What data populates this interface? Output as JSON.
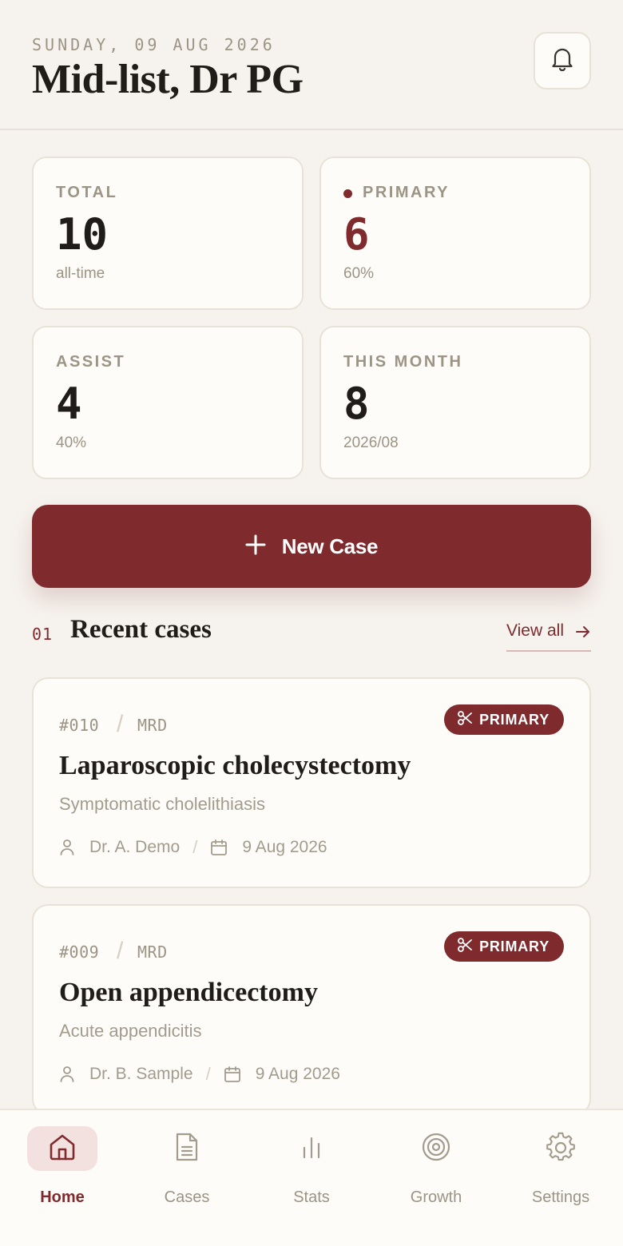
{
  "header": {
    "date": "SUNDAY, 09 AUG 2026",
    "title": "Mid-list, Dr PG",
    "notification_icon": "bell-icon"
  },
  "stats": [
    {
      "label": "TOTAL",
      "value": "10",
      "sub": "all-time"
    },
    {
      "label": "PRIMARY",
      "value": "6",
      "sub": "60%"
    },
    {
      "label": "ASSIST",
      "value": "4",
      "sub": "40%"
    },
    {
      "label": "THIS MONTH",
      "value": "8",
      "sub": "2026/08"
    }
  ],
  "new_case": {
    "label": "New Case",
    "icon": "plus-icon"
  },
  "recent": {
    "number": "01",
    "title": "Recent cases",
    "view_all": "View all"
  },
  "cases": [
    {
      "id": "#010",
      "unit": "MRD",
      "badge": "PRIMARY",
      "title": "Laparoscopic cholecystectomy",
      "diagnosis": "Symptomatic cholelithiasis",
      "doctor": "Dr. A. Demo",
      "date": "9 Aug 2026"
    },
    {
      "id": "#009",
      "unit": "MRD",
      "badge": "PRIMARY",
      "title": "Open appendicectomy",
      "diagnosis": "Acute appendicitis",
      "doctor": "Dr. B. Sample",
      "date": "9 Aug 2026"
    }
  ],
  "nav": [
    {
      "label": "Home",
      "icon": "home-icon",
      "active": true
    },
    {
      "label": "Cases",
      "icon": "document-icon",
      "active": false
    },
    {
      "label": "Stats",
      "icon": "bar-chart-icon",
      "active": false
    },
    {
      "label": "Growth",
      "icon": "target-icon",
      "active": false
    },
    {
      "label": "Settings",
      "icon": "gear-icon",
      "active": false
    }
  ],
  "colors": {
    "accent": "#7f2b2d",
    "background": "#f6f3ee",
    "card": "#fdfcf9",
    "muted_text": "#9c9484"
  }
}
